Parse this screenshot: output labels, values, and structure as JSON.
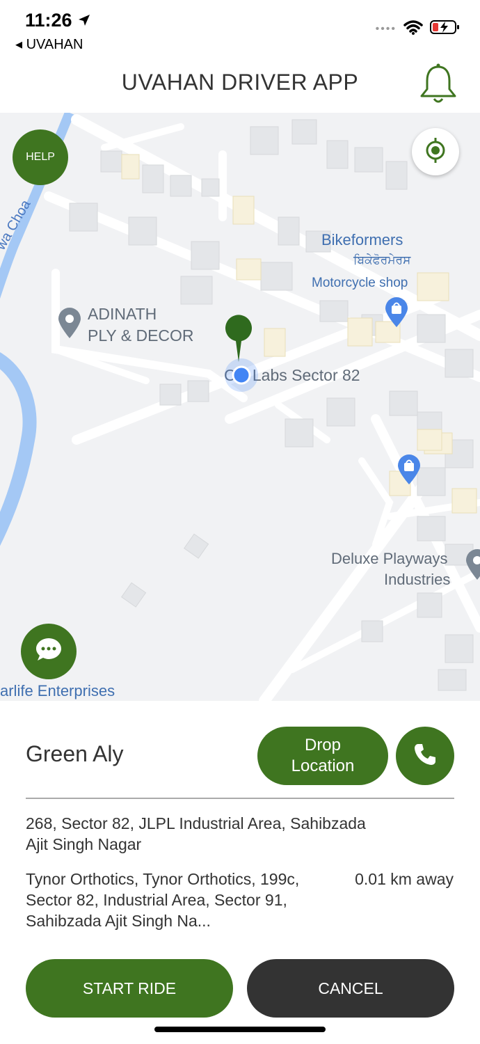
{
  "status_bar": {
    "time": "11:26",
    "back_app": "◂ UVAHAN"
  },
  "header": {
    "title": "UVAHAN DRIVER APP"
  },
  "map": {
    "help_label": "HELP",
    "labels": {
      "water": "wa Choa",
      "bikeformers": "Bikeformers",
      "bikeformers_punjabi": "ਬਿਕੇਫੋਰਮੇਰਸ",
      "motorcycle_shop": "Motorcycle shop",
      "adinath_line1": "ADINATH",
      "adinath_line2": "PLY & DECOR",
      "cook_labs": "C   k Labs Sector 82",
      "deluxe_line1": "Deluxe Playways",
      "deluxe_line2": "Industries",
      "starlife": "arlife Enterprises"
    }
  },
  "ride": {
    "passenger_name": "Green Aly",
    "drop_label": "Drop\nLocation",
    "pickup_address": "268, Sector 82, JLPL Industrial Area, Sahibzada Ajit Singh Nagar",
    "drop_address": "Tynor Orthotics, Tynor Orthotics, 199c, Sector 82, Industrial Area, Sector 91, Sahibzada Ajit Singh Na...",
    "distance": "0.01 km away",
    "start_label": "START RIDE",
    "cancel_label": "CANCEL"
  },
  "colors": {
    "brand_green": "#3f7520",
    "dark_button": "#333333",
    "map_blue": "#4285f4"
  }
}
